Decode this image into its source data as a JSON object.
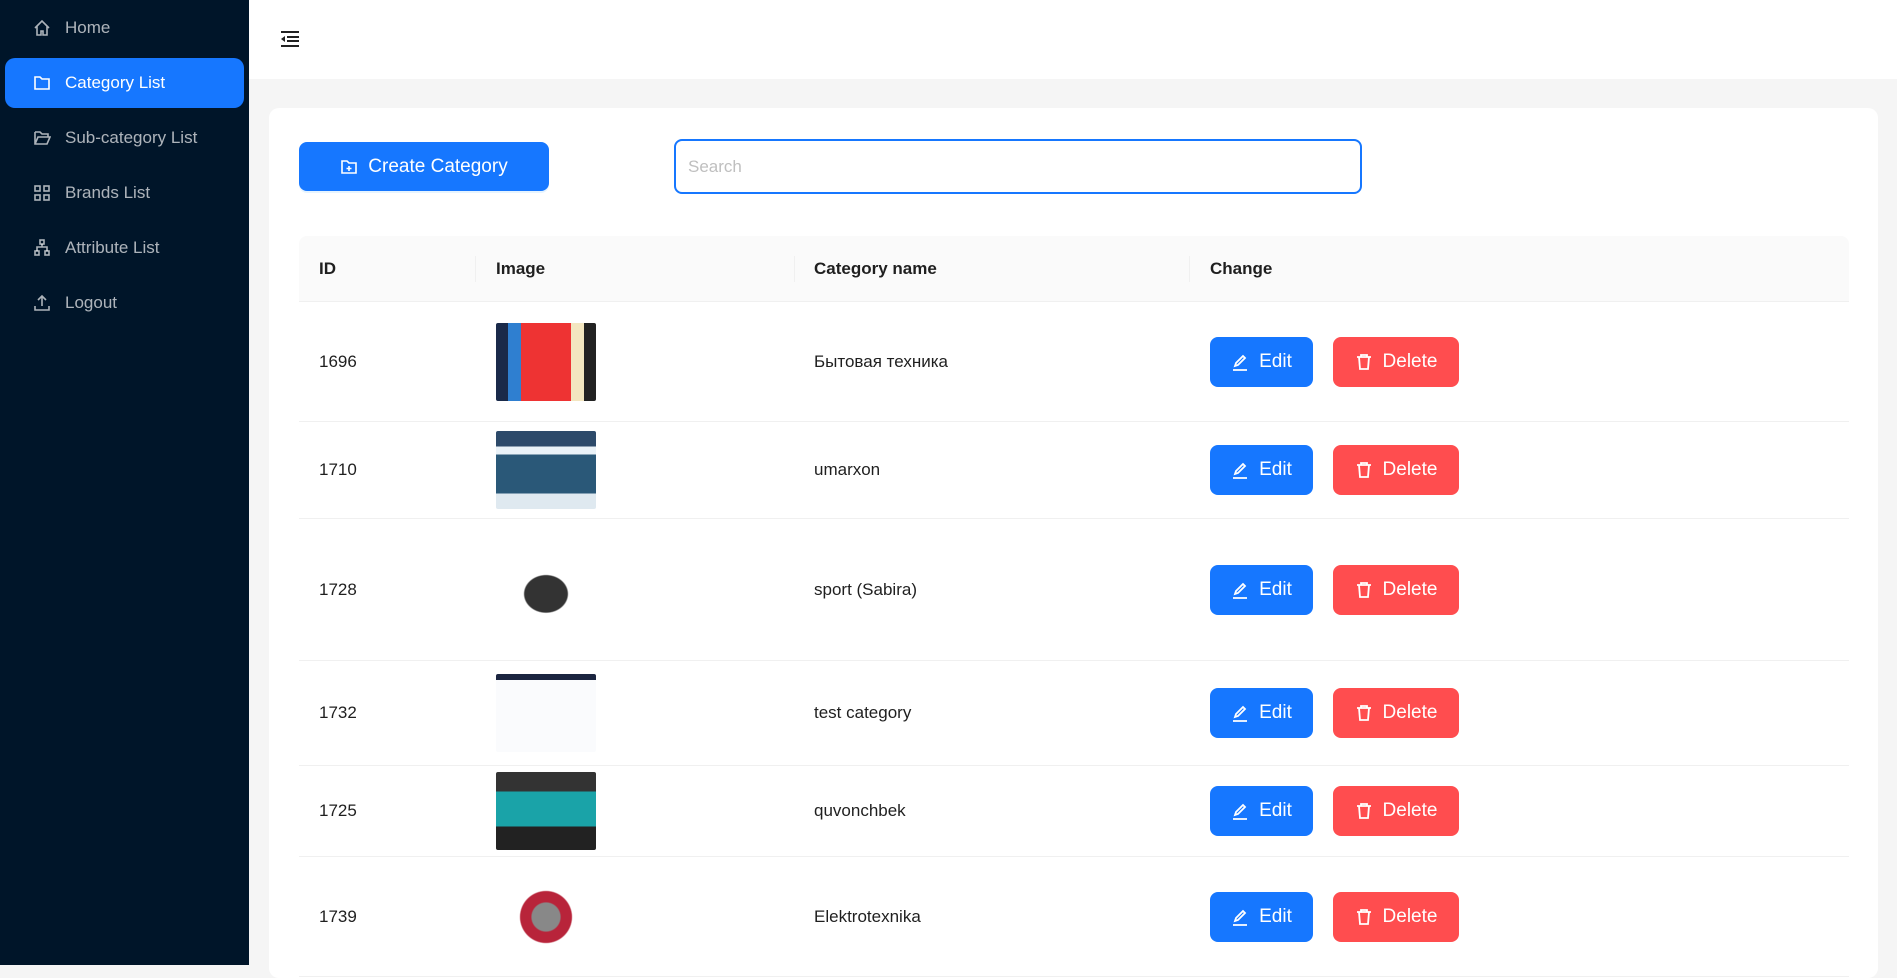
{
  "sidebar": {
    "items": [
      {
        "label": "Home",
        "icon": "home-icon",
        "active": false
      },
      {
        "label": "Category List",
        "icon": "folder-icon",
        "active": true
      },
      {
        "label": "Sub-category List",
        "icon": "folder-open-icon",
        "active": false
      },
      {
        "label": "Brands List",
        "icon": "grid-icon",
        "active": false
      },
      {
        "label": "Attribute List",
        "icon": "hierarchy-icon",
        "active": false
      },
      {
        "label": "Logout",
        "icon": "upload-icon",
        "active": false
      }
    ]
  },
  "toolbar": {
    "create_label": "Create Category",
    "search_placeholder": "Search"
  },
  "table": {
    "columns": [
      "ID",
      "Image",
      "Category name",
      "Change"
    ],
    "rows": [
      {
        "id": "1696",
        "name": "Бытовая техника"
      },
      {
        "id": "1710",
        "name": "umarxon"
      },
      {
        "id": "1728",
        "name": "sport (Sabira)"
      },
      {
        "id": "1732",
        "name": "test category"
      },
      {
        "id": "1725",
        "name": "quvonchbek"
      },
      {
        "id": "1739",
        "name": "Elektrotexnika"
      }
    ],
    "edit_label": "Edit",
    "delete_label": "Delete"
  },
  "colors": {
    "primary": "#1677ff",
    "danger": "#ff4d4f",
    "sidebar": "#001529"
  }
}
